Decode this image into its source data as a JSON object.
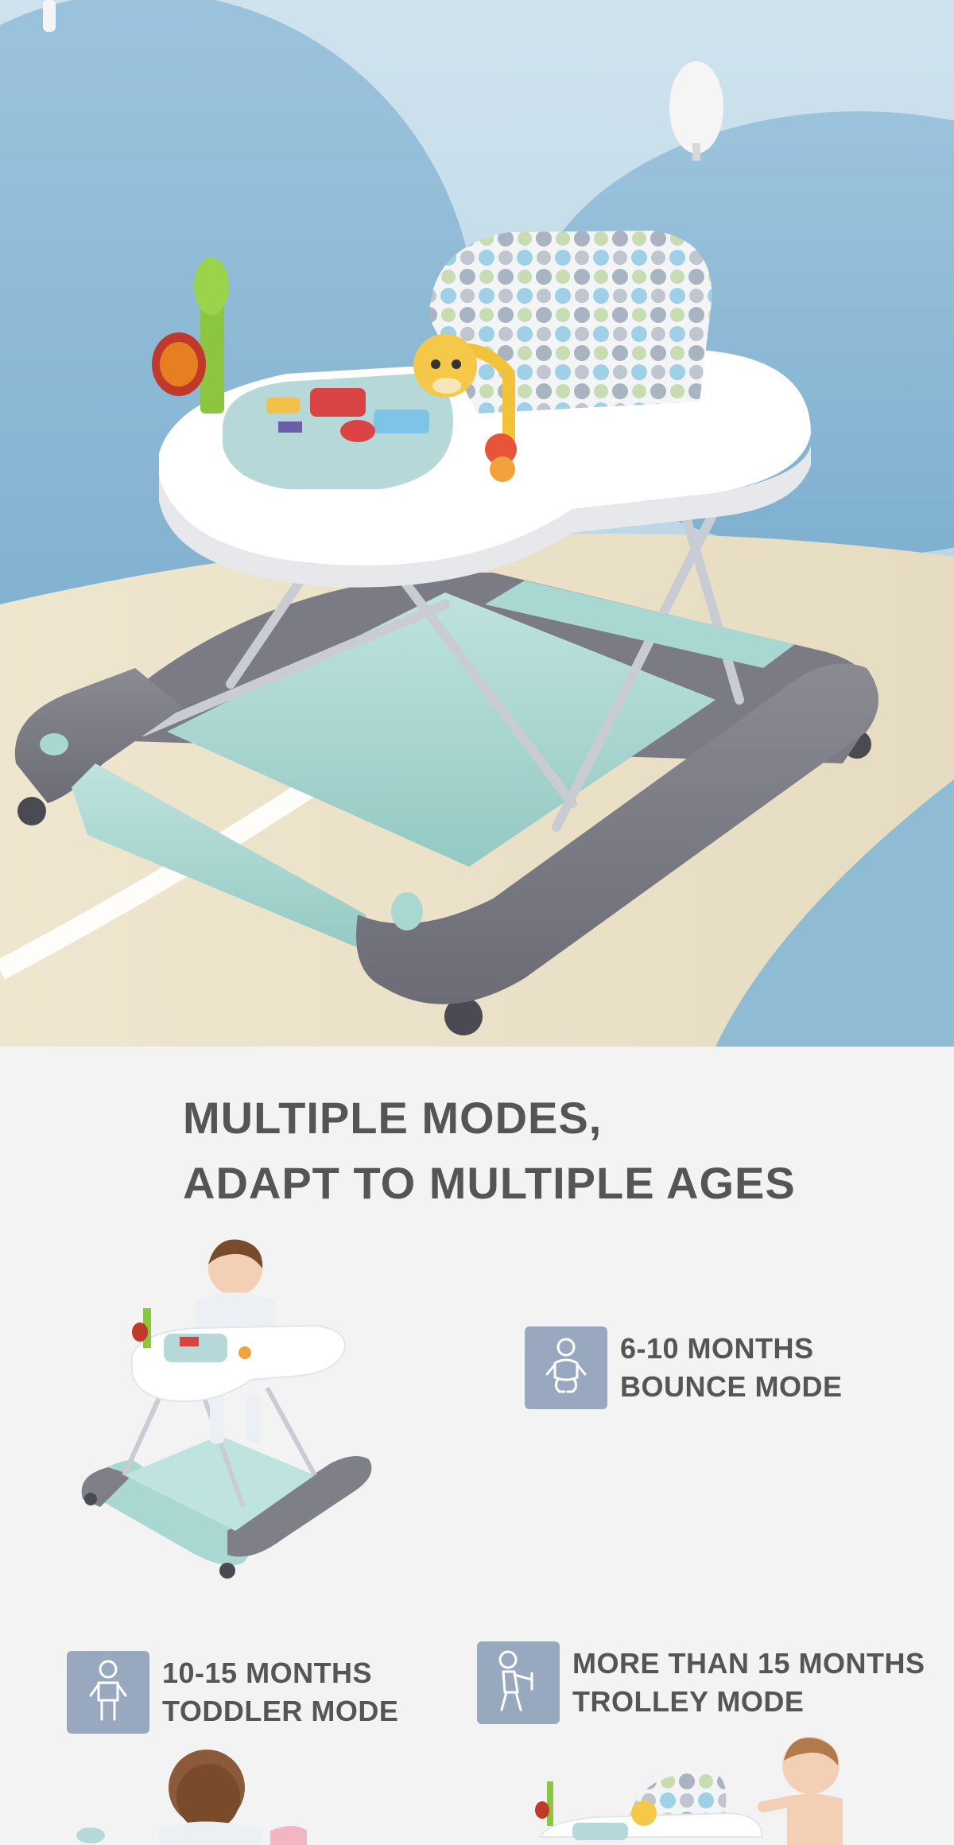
{
  "heading": {
    "line1": "MULTIPLE MODES,",
    "line2": "ADAPT TO MULTIPLE AGES"
  },
  "modes": [
    {
      "icon": "baby-sitting-icon",
      "age": "6-10 MONTHS",
      "name": "BOUNCE MODE"
    },
    {
      "icon": "baby-standing-icon",
      "age": "10-15 MONTHS",
      "name": "TODDLER MODE"
    },
    {
      "icon": "baby-pushing-icon",
      "age": "MORE THAN 15 MONTHS",
      "name": "TROLLEY MODE"
    }
  ],
  "colors": {
    "background": "#f3f3f3",
    "icon_badge": "#98a8bf",
    "text": "#555555",
    "walker_gray": "#7f7f88",
    "walker_mint": "#a9d7d2",
    "tray_white": "#ffffff"
  }
}
